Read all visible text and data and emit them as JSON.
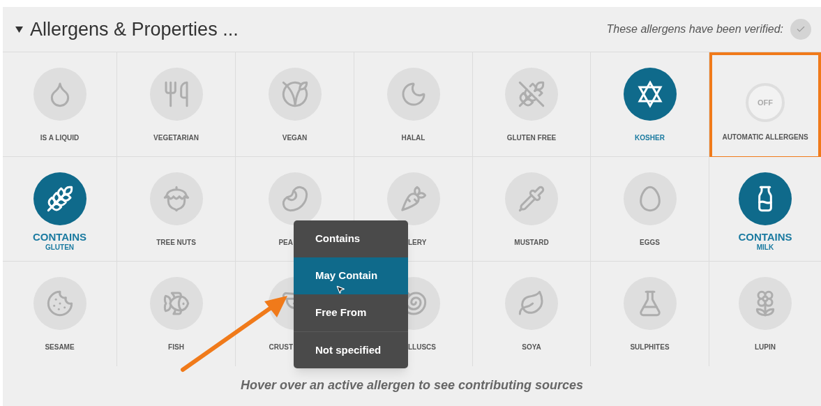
{
  "header": {
    "title": "Allergens & Properties ...",
    "verified_text": "These allergens have been verified:",
    "verified": false
  },
  "cells": [
    {
      "kind": "allergen",
      "label": "IS A LIQUID",
      "active": false
    },
    {
      "kind": "allergen",
      "label": "VEGETARIAN",
      "active": false
    },
    {
      "kind": "allergen",
      "label": "VEGAN",
      "active": false
    },
    {
      "kind": "allergen",
      "label": "HALAL",
      "active": false
    },
    {
      "kind": "allergen",
      "label": "GLUTEN FREE",
      "active": false
    },
    {
      "kind": "allergen",
      "label": "KOSHER",
      "active": true
    },
    {
      "kind": "toggle",
      "value": "OFF",
      "label": "AUTOMATIC ALLERGENS",
      "on": false,
      "highlighted": true
    },
    {
      "kind": "allergen",
      "badge": "CONTAINS",
      "label": "GLUTEN",
      "active": true
    },
    {
      "kind": "allergen",
      "label": "TREE NUTS",
      "active": false
    },
    {
      "kind": "allergen",
      "label": "PEA",
      "active": false
    },
    {
      "kind": "allergen",
      "label": "LERY",
      "active": false
    },
    {
      "kind": "allergen",
      "label": "MUSTARD",
      "active": false
    },
    {
      "kind": "allergen",
      "label": "EGGS",
      "active": false
    },
    {
      "kind": "allergen",
      "badge": "CONTAINS",
      "label": "MILK",
      "active": true
    },
    {
      "kind": "allergen",
      "label": "SESAME",
      "active": false
    },
    {
      "kind": "allergen",
      "label": "FISH",
      "active": false
    },
    {
      "kind": "allergen",
      "label": "CRUST",
      "active": false
    },
    {
      "kind": "allergen",
      "label": "LLUSCS",
      "active": false
    },
    {
      "kind": "allergen",
      "label": "SOYA",
      "active": false
    },
    {
      "kind": "allergen",
      "label": "SULPHITES",
      "active": false
    },
    {
      "kind": "allergen",
      "label": "LUPIN",
      "active": false
    }
  ],
  "menu": {
    "items": [
      {
        "label": "Contains",
        "selected": false
      },
      {
        "label": "May Contain",
        "selected": true
      },
      {
        "label": "Free From",
        "selected": false
      },
      {
        "label": "Not specified",
        "selected": false
      }
    ]
  },
  "footer": {
    "hint": "Hover over an active allergen to see contributing sources"
  }
}
